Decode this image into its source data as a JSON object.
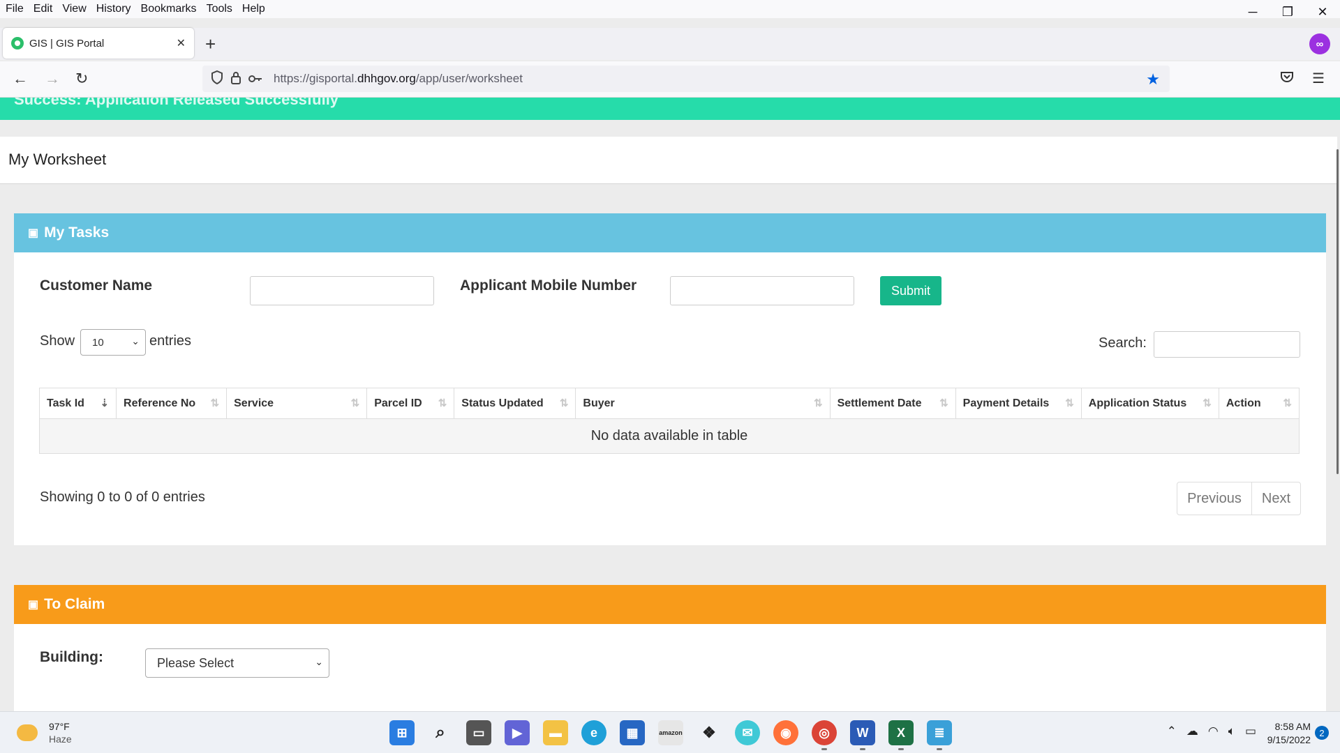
{
  "menubar": {
    "items": [
      "File",
      "Edit",
      "View",
      "History",
      "Bookmarks",
      "Tools",
      "Help"
    ]
  },
  "window_controls": {
    "minimize": "─",
    "restore": "❐",
    "close": "✕"
  },
  "tab": {
    "title": "GIS | GIS Portal",
    "close": "✕",
    "new_tab": "+"
  },
  "account_icon": "∞",
  "nav": {
    "back": "←",
    "forward": "→",
    "reload": "↻"
  },
  "url": {
    "prefix": "https://gisportal.",
    "domain": "dhhgov.org",
    "path": "/app/user/worksheet"
  },
  "alert": {
    "text": "Success: Application Released Successfully"
  },
  "page": {
    "title": "My Worksheet"
  },
  "tasks": {
    "title": "My Tasks",
    "customer_name_label": "Customer Name",
    "mobile_label": "Applicant Mobile Number",
    "submit_label": "Submit",
    "show_label": "Show",
    "entries_value": "10",
    "entries_label": "entries",
    "search_label": "Search:",
    "columns": [
      "Task Id",
      "Reference No",
      "Service",
      "Parcel ID",
      "Status Updated",
      "Buyer",
      "Settlement Date",
      "Payment Details",
      "Application Status",
      "Action"
    ],
    "empty_message": "No data available in table",
    "info": "Showing 0 to 0 of 0 entries",
    "previous_label": "Previous",
    "next_label": "Next"
  },
  "claim": {
    "title": "To Claim",
    "building_label": "Building:",
    "building_value": "Please Select"
  },
  "taskbar": {
    "temperature": "97°F",
    "condition": "Haze",
    "time": "8:58 AM",
    "date": "9/15/2022",
    "notifications": "2"
  }
}
